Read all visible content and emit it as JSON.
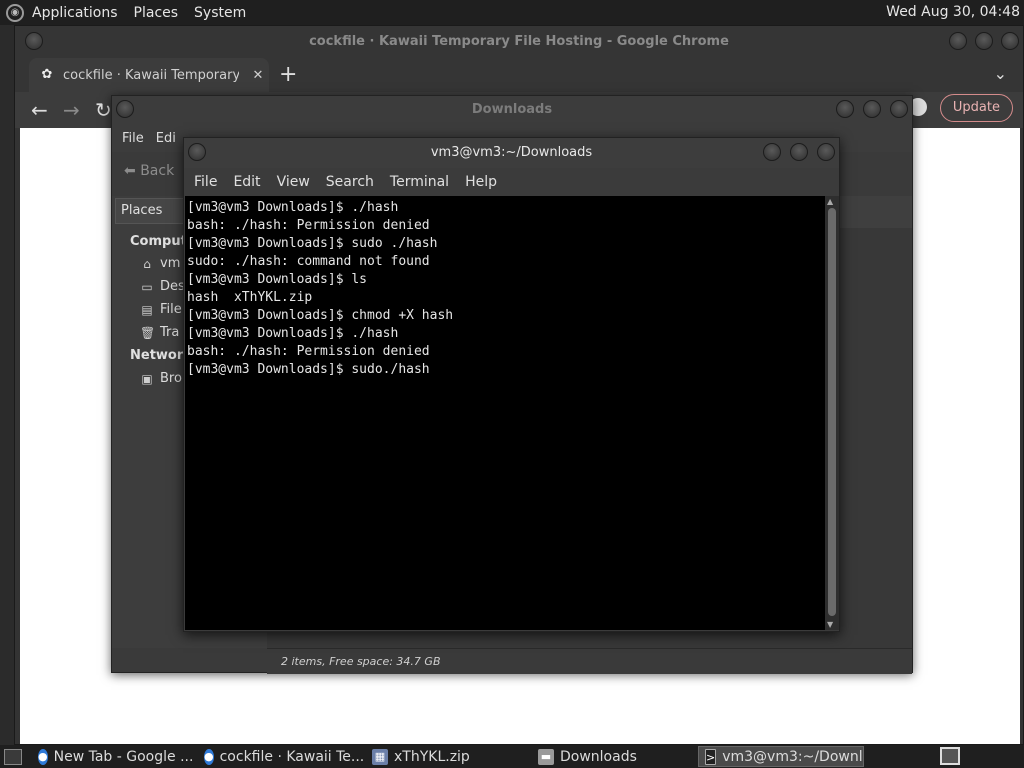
{
  "top_panel": {
    "menus": [
      "Applications",
      "Places",
      "System"
    ],
    "clock": "Wed Aug 30, 04:48"
  },
  "chrome": {
    "window_title": "cockfile · Kawaii Temporary File Hosting - Google Chrome",
    "tab_title": "cockfile · Kawaii Temporary Fi",
    "tab_close": "✕",
    "new_tab": "+",
    "tab_menu": "⌄",
    "update_label": "Update"
  },
  "files": {
    "window_title": "Downloads",
    "menus": [
      "File",
      "Edi"
    ],
    "back_label": "Back",
    "places_header": "Places",
    "sections": [
      "Compute",
      "Network"
    ],
    "items": [
      "vm",
      "Des",
      "File",
      "Tra",
      "Bro"
    ],
    "status": "2 items, Free space: 34.7 GB"
  },
  "terminal": {
    "window_title": "vm3@vm3:~/Downloads",
    "menus": [
      "File",
      "Edit",
      "View",
      "Search",
      "Terminal",
      "Help"
    ],
    "lines": [
      "[vm3@vm3 Downloads]$ ./hash",
      "bash: ./hash: Permission denied",
      "[vm3@vm3 Downloads]$ sudo ./hash",
      "sudo: ./hash: command not found",
      "[vm3@vm3 Downloads]$ ls",
      "hash  xThYKL.zip",
      "[vm3@vm3 Downloads]$ chmod +X hash",
      "[vm3@vm3 Downloads]$ ./hash",
      "bash: ./hash: Permission denied",
      "[vm3@vm3 Downloads]$ sudo./hash"
    ]
  },
  "taskbar": {
    "tasks": [
      {
        "label": "New Tab - Google ...",
        "icon": "chrome-icon"
      },
      {
        "label": "cockfile · Kawaii Te...",
        "icon": "chrome-icon"
      },
      {
        "label": "xThYKL.zip",
        "icon": "archive-icon"
      },
      {
        "label": "Downloads",
        "icon": "folder-icon"
      },
      {
        "label": "vm3@vm3:~/Downl...",
        "icon": "terminal-icon"
      }
    ]
  },
  "colors": {
    "panel_bg": "#1f1f1f",
    "window_bg": "#3b3b3b",
    "terminal_bg": "#000000",
    "update_accent": "#d48b8b"
  }
}
